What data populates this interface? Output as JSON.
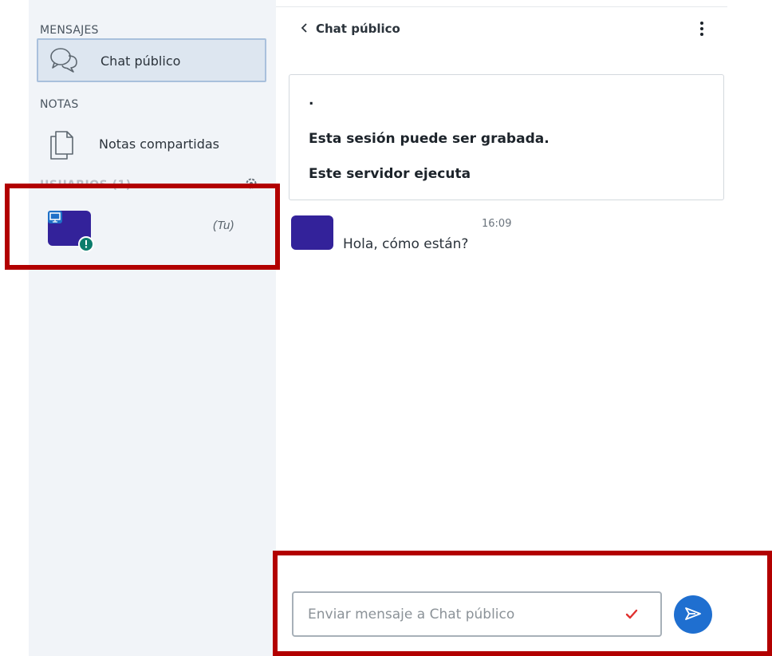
{
  "sidebar": {
    "messages_section": "MENSAJES",
    "public_chat_item": "Chat público",
    "notes_section": "NOTAS",
    "shared_notes_item": "Notas compartidas",
    "users_section": "USUARIOS (1)",
    "current_user_you": "(Tu)"
  },
  "chat": {
    "header_title": "Chat público",
    "welcome": {
      "dot": ".",
      "recording_notice": "Esta sesión puede ser grabada.",
      "server_notice": "Este servidor ejecuta"
    },
    "messages": [
      {
        "time": "16:09",
        "text": "Hola, cómo están?"
      }
    ],
    "input_placeholder": "Enviar mensaje a Chat público"
  },
  "icons": {
    "chat": "chat-bubbles-icon",
    "notes": "notes-icon",
    "settings": "gear-icon",
    "back": "chevron-left-icon",
    "menu": "kebab-menu-icon",
    "send": "send-icon",
    "spellcheck": "spellcheck-icon"
  },
  "colors": {
    "avatar": "#33229a",
    "accent_send": "#1f6fd0",
    "highlight": "#b20000",
    "sidebar_bg": "#f1f4f8"
  }
}
